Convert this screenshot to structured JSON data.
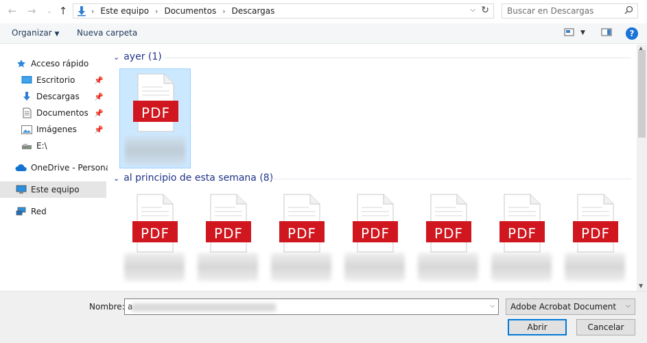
{
  "address": {
    "segments": [
      "Este equipo",
      "Documentos",
      "Descargas"
    ]
  },
  "search": {
    "placeholder": "Buscar en Descargas"
  },
  "toolbar": {
    "organize_label": "Organizar",
    "new_folder_label": "Nueva carpeta",
    "help_label": "?"
  },
  "sidebar": {
    "items": [
      {
        "label": "Acceso rápido",
        "icon": "star-icon"
      },
      {
        "label": "Escritorio",
        "icon": "desktop-folder-icon",
        "pinned": true
      },
      {
        "label": "Descargas",
        "icon": "download-arrow-icon",
        "pinned": true
      },
      {
        "label": "Documentos",
        "icon": "documents-icon",
        "pinned": true
      },
      {
        "label": "Imágenes",
        "icon": "pictures-icon",
        "pinned": true
      },
      {
        "label": "E:\\",
        "icon": "usb-drive-icon"
      },
      {
        "label": "OneDrive - Personal",
        "icon": "cloud-icon"
      },
      {
        "label": "Este equipo",
        "icon": "computer-icon"
      },
      {
        "label": "Red",
        "icon": "network-icon"
      }
    ]
  },
  "groups": [
    {
      "title": "ayer (1)",
      "files": 1
    },
    {
      "title": "al principio de esta semana (8)",
      "files": 7
    }
  ],
  "file_icon_label": "PDF",
  "colors": {
    "pdf_red": "#d0161e",
    "accent": "#0078d7",
    "group_header": "#1e3287"
  },
  "bottom": {
    "name_label": "Nombre:",
    "name_value": "a",
    "file_type": "Adobe Acrobat Document",
    "open_label": "Abrir",
    "cancel_label": "Cancelar"
  }
}
